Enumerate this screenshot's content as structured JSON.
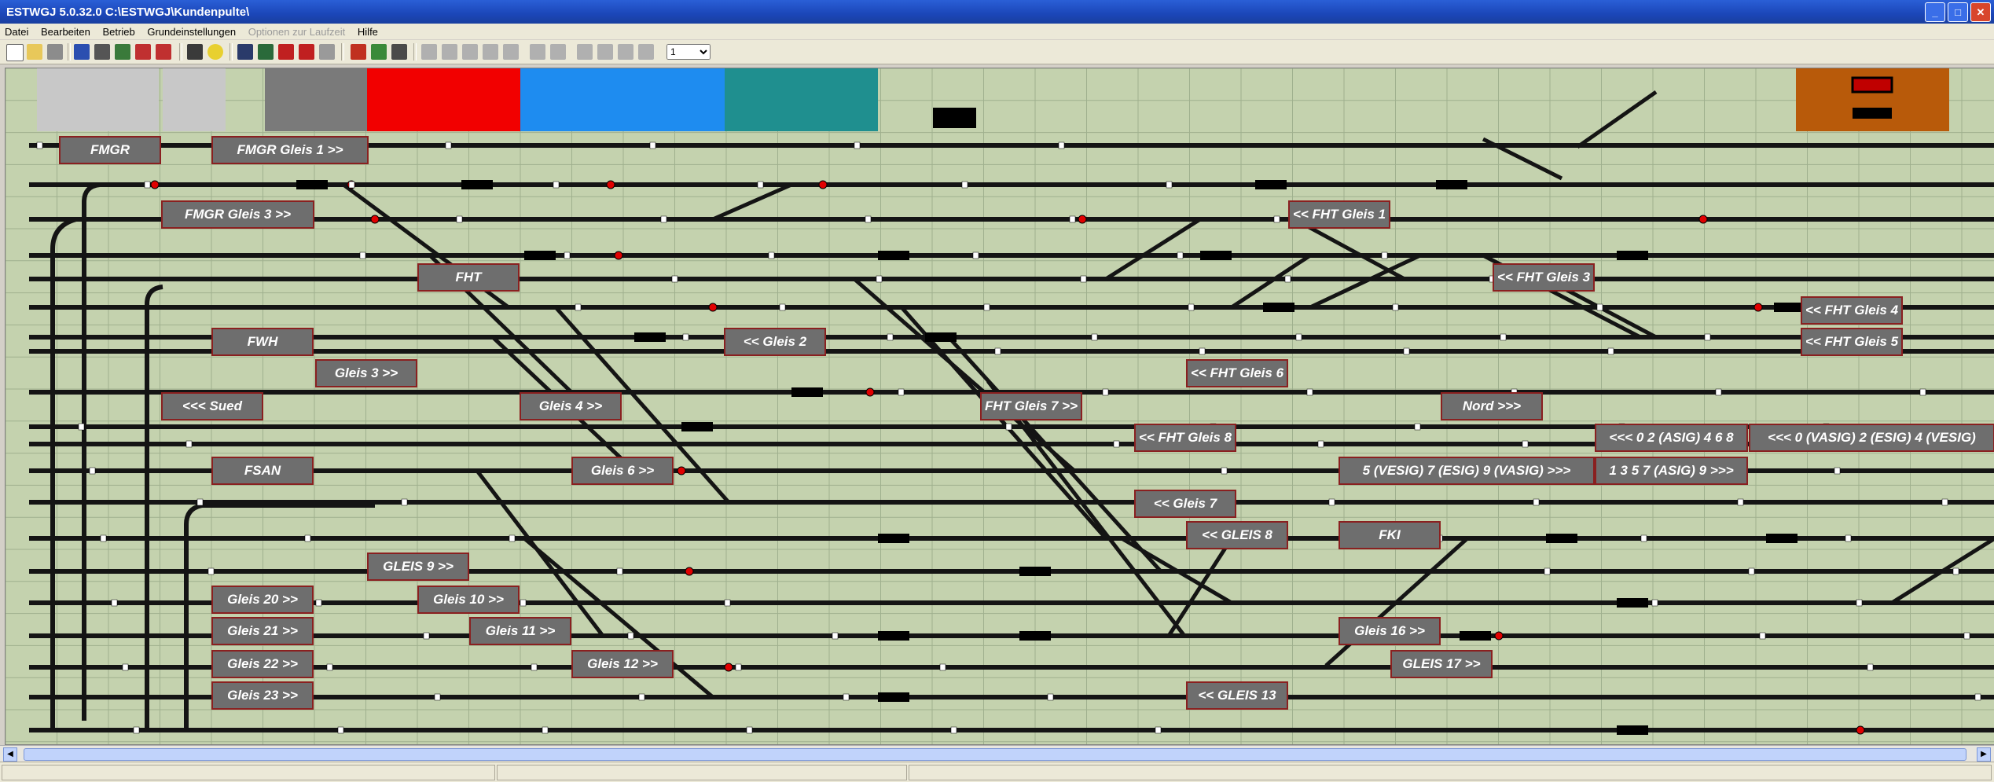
{
  "window": {
    "title": "ESTWGJ 5.0.32.0  C:\\ESTWGJ\\Kundenpulte\\"
  },
  "menu": [
    {
      "label": "Datei",
      "enabled": true
    },
    {
      "label": "Bearbeiten",
      "enabled": true
    },
    {
      "label": "Betrieb",
      "enabled": true
    },
    {
      "label": "Grundeinstellungen",
      "enabled": true
    },
    {
      "label": "Optionen zur Laufzeit",
      "enabled": false
    },
    {
      "label": "Hilfe",
      "enabled": true
    }
  ],
  "toolbar": {
    "selector_value": "1"
  },
  "labels": {
    "fmgr": "FMGR",
    "fmgr_gleis1": "FMGR Gleis 1 >>",
    "fmgr_gleis3": "FMGR Gleis 3 >>",
    "fht": "FHT",
    "fwh": "FWH",
    "gleis3": "Gleis 3 >>",
    "sued": "<<< Sued",
    "gleis4": "Gleis 4 >>",
    "gleis2": "<< Gleis 2",
    "fsan": "FSAN",
    "gleis6": "Gleis 6 >>",
    "gleis9": "GLEIS 9 >>",
    "gleis10": "Gleis 10 >>",
    "gleis20": "Gleis 20 >>",
    "gleis11": "Gleis 11 >>",
    "gleis21": "Gleis 21 >>",
    "gleis22": "Gleis 22 >>",
    "gleis12": "Gleis 12 >>",
    "gleis23": "Gleis 23 >>",
    "fht_gleis7": "FHT Gleis 7 >>",
    "fht_gleis8": "<< FHT Gleis 8",
    "gleis7": "<< Gleis 7",
    "gleis8b": "<< GLEIS 8",
    "gleis13": "<< GLEIS 13",
    "fht_gleis1": "<< FHT Gleis 1",
    "fht_gleis6": "<< FHT Gleis 6",
    "fht_gleis3": "<< FHT Gleis 3",
    "nord": "Nord >>>",
    "asig1": "<<< 0 2 (ASIG) 4 6 8",
    "vasig0": "<<< 0 (VASIG) 2 (ESIG) 4 (VESIG)",
    "vesig5": "5 (VESIG) 7 (ESIG) 9 (VASIG) >>>",
    "asig2": "1 3 5 7 (ASIG) 9 >>>",
    "fki": "FKI",
    "gleis16": "Gleis 16 >>",
    "gleis17": "GLEIS 17 >>",
    "fht_gleis4": "<< FHT Gleis 4",
    "fht_gleis5": "<< FHT Gleis 5"
  },
  "colors": {
    "panel_bg": "#c4d2ae",
    "track": "#141414",
    "label_bg": "#6e6e6e",
    "label_border": "#8a2020",
    "block_red": "#f20000",
    "block_blue": "#1e8cf0",
    "block_teal": "#1f8f8f",
    "block_orange": "#b85a0a"
  }
}
